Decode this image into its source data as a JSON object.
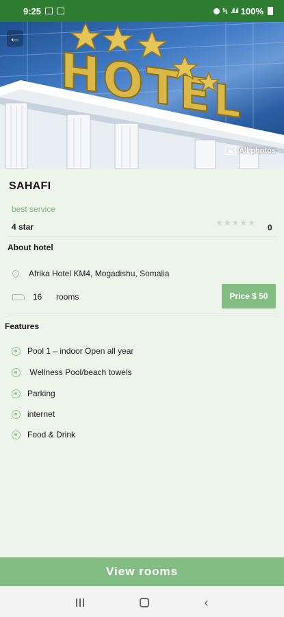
{
  "status_bar": {
    "time": "9:25",
    "battery": "100%"
  },
  "hero": {
    "sign_text": "HOTEL",
    "all_photos_label": "All photos"
  },
  "hotel": {
    "name": "SAHAFI",
    "tagline": "best service",
    "star_class": "4 star",
    "rating_count": "0",
    "rating_stars": 0
  },
  "about": {
    "title": "About hotel",
    "address": "Afrika Hotel KM4, Mogadishu, Somalia",
    "rooms_count": "16",
    "rooms_label": "rooms",
    "price_label": "Price $ 50"
  },
  "features": {
    "title": "Features",
    "items": [
      "Pool 1 – indoor Open all year",
      " Wellness Pool/beach towels",
      "Parking",
      "internet",
      "Food & Drink"
    ]
  },
  "actions": {
    "view_rooms_label": "View rooms"
  },
  "colors": {
    "status_bar": "#2e7d32",
    "accent": "#84bd84",
    "background": "#edf5ea"
  }
}
